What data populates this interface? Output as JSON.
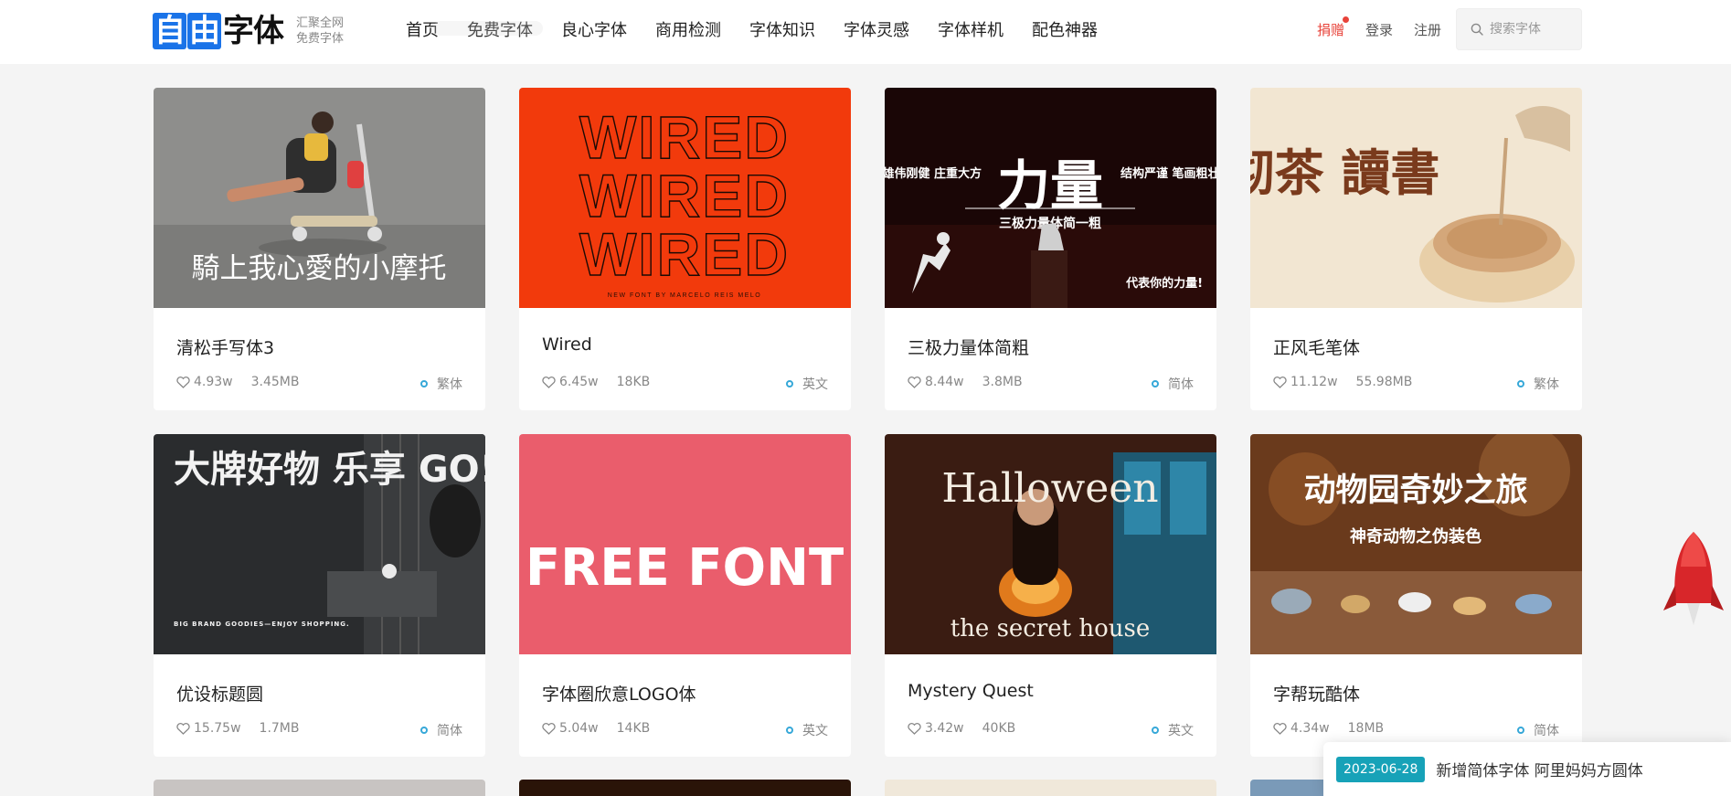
{
  "header": {
    "logo_text": "自由字体",
    "logo_sub_1": "汇聚全网",
    "logo_sub_2": "免费字体",
    "nav": [
      "首页",
      "免费字体",
      "良心字体",
      "商用检测",
      "字体知识",
      "字体灵感",
      "字体样机",
      "配色神器"
    ],
    "donate": "捐赠",
    "login": "登录",
    "register": "注册",
    "search_placeholder": "搜索字体"
  },
  "fonts": [
    {
      "title": "清松手写体3",
      "likes": "4.93w",
      "size": "3.45MB",
      "tag": "繁体",
      "thumb_text": "騎上我心愛的小摩托"
    },
    {
      "title": "Wired",
      "likes": "6.45w",
      "size": "18KB",
      "tag": "英文",
      "thumb_text": "WIRED",
      "thumb_caption": "NEW FONT BY MARCELO REIS MELO"
    },
    {
      "title": "三极力量体简粗",
      "likes": "8.44w",
      "size": "3.8MB",
      "tag": "简体",
      "thumb_text": "力量",
      "thumb_left": "雄伟刚健 庄重大方",
      "thumb_right": "结构严谨 笔画粗壮",
      "thumb_sub": "三极力量体简一粗",
      "thumb_tagline": "代表你的力量!"
    },
    {
      "title": "正风毛笔体",
      "likes": "11.12w",
      "size": "55.98MB",
      "tag": "繁体",
      "thumb_text": "沏茶 讀書"
    },
    {
      "title": "优设标题圆",
      "likes": "15.75w",
      "size": "1.7MB",
      "tag": "简体",
      "thumb_text": "大牌好物 乐享 GO!",
      "thumb_caption": "BIG BRAND GOODIES—ENJOY SHOPPING."
    },
    {
      "title": "字体圈欣意LOGO体",
      "likes": "5.04w",
      "size": "14KB",
      "tag": "英文",
      "thumb_text": "FREE FONT"
    },
    {
      "title": "Mystery Quest",
      "likes": "3.42w",
      "size": "40KB",
      "tag": "英文",
      "thumb_text": "Halloween",
      "thumb_caption": "the secret house"
    },
    {
      "title": "字帮玩酷体",
      "likes": "4.34w",
      "size": "18MB",
      "tag": "简体",
      "thumb_text": "动物园奇妙之旅",
      "thumb_sub": "神奇动物之伪装色"
    }
  ],
  "notice": {
    "date": "2023-06-28",
    "text": "新增简体字体 阿里妈妈方圆体"
  },
  "colors": {
    "brand_blue": "#1a73e8",
    "donate_red": "#e8433a",
    "tag_ring": "#36a8d8",
    "notice_date_bg": "#17a2b8"
  }
}
